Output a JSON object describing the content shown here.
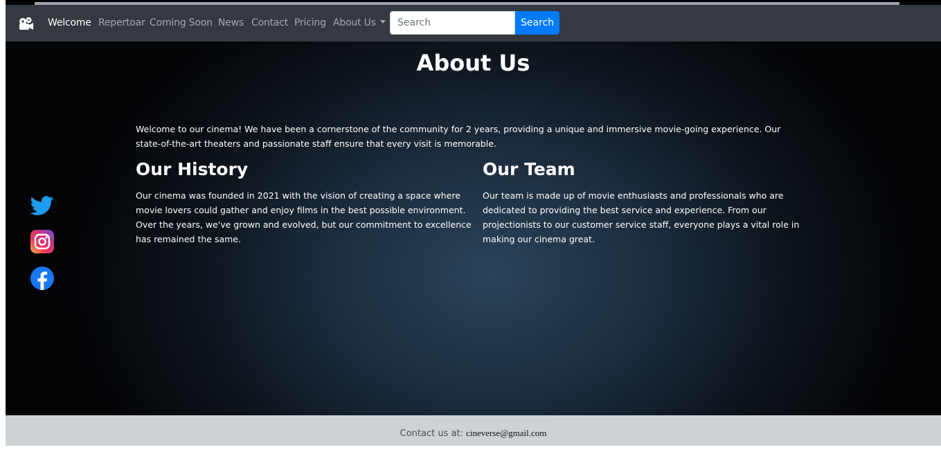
{
  "nav": {
    "items": [
      {
        "label": "Welcome",
        "active": true
      },
      {
        "label": "Repertoar"
      },
      {
        "label": "Coming Soon"
      },
      {
        "label": "News"
      },
      {
        "label": "Contact"
      },
      {
        "label": "Pricing"
      },
      {
        "label": "About Us",
        "dropdown": true
      }
    ],
    "search_placeholder": "Search",
    "search_button": "Search"
  },
  "main": {
    "title": "About Us",
    "intro": "Welcome to our cinema! We have been a cornerstone of the community for 2 years, providing a unique and immersive movie-going experience. Our state-of-the-art theaters and passionate staff ensure that every visit is memorable.",
    "history": {
      "heading": "Our History",
      "text": "Our cinema was founded in 2021 with the vision of creating a space where movie lovers could gather and enjoy films in the best possible environment. Over the years, we've grown and evolved, but our commitment to excellence has remained the same."
    },
    "team": {
      "heading": "Our Team",
      "text": "Our team is made up of movie enthusiasts and professionals who are dedicated to providing the best service and experience. From our projectionists to our customer service staff, everyone plays a vital role in making our cinema great."
    }
  },
  "social": {
    "icons": [
      "twitter-icon",
      "instagram-icon",
      "facebook-icon"
    ]
  },
  "footer": {
    "label": "Contact us at:",
    "email": "cineverse@gmail.com"
  },
  "colors": {
    "navbar": "#343a40",
    "search_button": "#007bff",
    "footer": "#ced1d5",
    "twitter": "#1d9bf0",
    "facebook": "#1877f2"
  }
}
